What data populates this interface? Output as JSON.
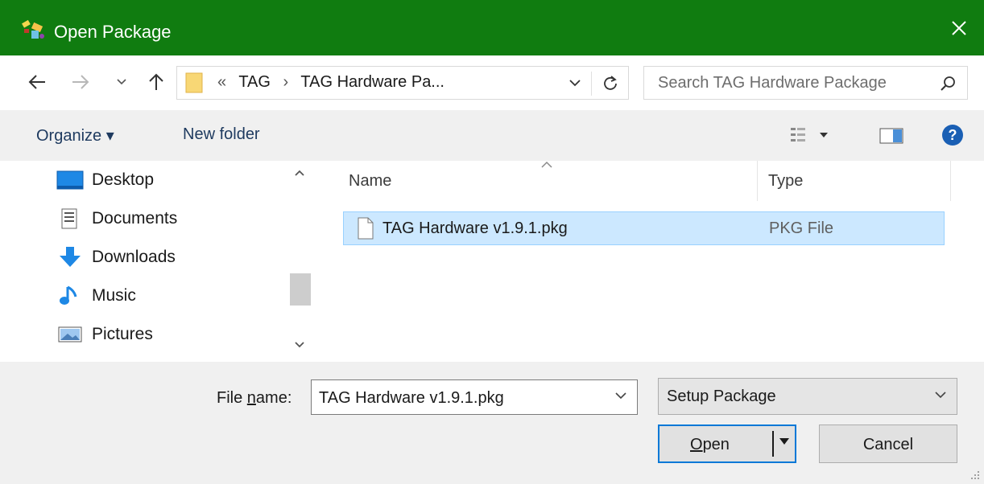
{
  "window": {
    "title": "Open Package",
    "close_label": "✕",
    "accent": "#107c10"
  },
  "address_bar": {
    "overflow": "«",
    "crumbs": [
      "TAG",
      "›",
      "TAG Hardware Pa..."
    ]
  },
  "search": {
    "placeholder": "Search TAG Hardware Package"
  },
  "toolbar": {
    "organize_label": "Organize ▾",
    "new_folder_label": "New folder"
  },
  "nav_pane": {
    "items": [
      {
        "label": "Desktop",
        "icon": "desktop-icon"
      },
      {
        "label": "Documents",
        "icon": "documents-icon"
      },
      {
        "label": "Downloads",
        "icon": "downloads-icon"
      },
      {
        "label": "Music",
        "icon": "music-icon"
      },
      {
        "label": "Pictures",
        "icon": "pictures-icon"
      }
    ]
  },
  "file_list": {
    "columns": {
      "name": "Name",
      "type": "Type"
    },
    "rows": [
      {
        "name": "TAG Hardware v1.9.1.pkg",
        "type": "PKG File",
        "selected": true
      }
    ]
  },
  "footer": {
    "file_name_label_pre": "File ",
    "file_name_label_ul": "n",
    "file_name_label_post": "ame:",
    "file_name_value": "TAG Hardware v1.9.1.pkg",
    "filter_value": "Setup Package",
    "open_ul": "O",
    "open_rest": "pen",
    "cancel_label": "Cancel"
  }
}
